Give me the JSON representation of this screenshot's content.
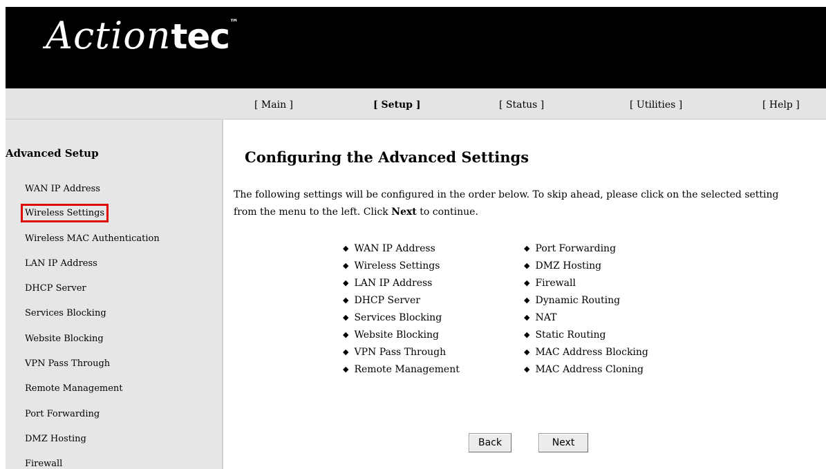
{
  "brand": {
    "script": "Action",
    "tec": "tec",
    "tm": "™"
  },
  "nav": [
    {
      "label": "[ Main ]",
      "active": false
    },
    {
      "label": "[ Setup ]",
      "active": true
    },
    {
      "label": "[ Status ]",
      "active": false
    },
    {
      "label": "[ Utilities ]",
      "active": false
    },
    {
      "label": "[ Help ]",
      "active": false
    }
  ],
  "sidebar": {
    "title": "Advanced Setup",
    "items": [
      {
        "label": "WAN IP Address"
      },
      {
        "label": "Wireless Settings",
        "highlighted": true
      },
      {
        "label": "Wireless MAC Authentication"
      },
      {
        "label": "LAN IP Address"
      },
      {
        "label": "DHCP Server"
      },
      {
        "label": "Services Blocking"
      },
      {
        "label": "Website Blocking"
      },
      {
        "label": "VPN Pass Through"
      },
      {
        "label": "Remote Management"
      },
      {
        "label": "Port Forwarding"
      },
      {
        "label": "DMZ Hosting"
      },
      {
        "label": "Firewall"
      }
    ]
  },
  "main": {
    "title": "Configuring the Advanced Settings",
    "intro_part1": "The following settings will be configured in the order below. To skip ahead, please click on the selected setting from the menu to the left. Click ",
    "intro_bold": "Next",
    "intro_part2": " to continue.",
    "list_left": [
      "WAN IP Address",
      "Wireless Settings",
      "LAN IP Address",
      "DHCP Server",
      "Services Blocking",
      "Website Blocking",
      "VPN Pass Through",
      "Remote Management"
    ],
    "list_right": [
      "Port Forwarding",
      "DMZ Hosting",
      "Firewall",
      "Dynamic Routing",
      "NAT",
      "Static Routing",
      "MAC Address Blocking",
      "MAC Address Cloning"
    ]
  },
  "buttons": {
    "back": "Back",
    "next": "Next"
  },
  "colors": {
    "banner": "#000000",
    "navbar": "#e4e4e4",
    "sidebar": "#e6e6e6",
    "highlight": "#e00000"
  }
}
